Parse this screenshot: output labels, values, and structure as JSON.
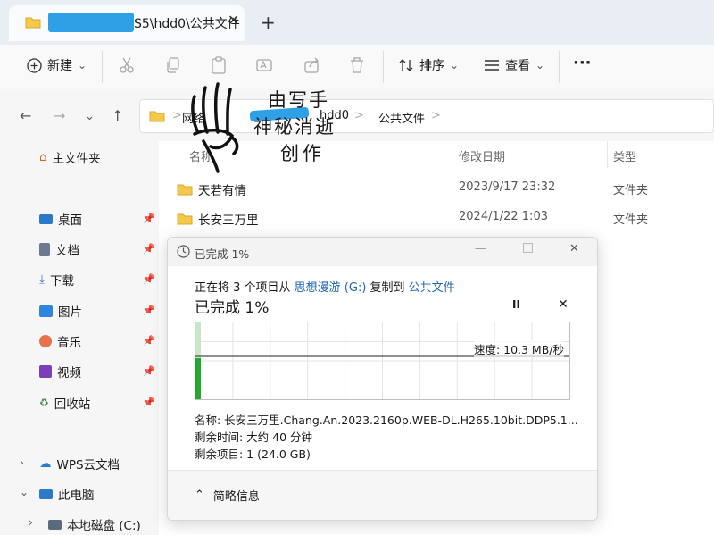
{
  "colors": {
    "accent": "#1f66b8",
    "progress": "#26a830",
    "redaction": "#2ea0e6",
    "folder": "#f5c84c"
  },
  "window": {
    "tab_title": "S5\\hdd0\\公共文件",
    "new_tab": "+",
    "close_icon": "close-icon"
  },
  "toolbar": {
    "new_label": "新建",
    "sort_label": "排序",
    "view_label": "查看",
    "more_label": "···"
  },
  "address": {
    "crumbs": [
      "网络",
      "hdd0",
      "公共文件"
    ],
    "separator": ">"
  },
  "sidebar": {
    "home": "主文件夹",
    "quick": [
      {
        "label": "桌面",
        "icon": "desktop-icon"
      },
      {
        "label": "文档",
        "icon": "document-icon"
      },
      {
        "label": "下载",
        "icon": "download-icon"
      },
      {
        "label": "图片",
        "icon": "pictures-icon"
      },
      {
        "label": "音乐",
        "icon": "music-icon"
      },
      {
        "label": "视频",
        "icon": "video-icon"
      },
      {
        "label": "回收站",
        "icon": "recycle-bin-icon"
      }
    ],
    "wps": "WPS云文档",
    "this_pc": "此电脑",
    "local_disk": "本地磁盘 (C:)"
  },
  "file_list": {
    "columns": {
      "name": "名称",
      "date": "修改日期",
      "type": "类型"
    },
    "rows": [
      {
        "name": "天若有情",
        "date": "2023/9/17 23:32",
        "type": "文件夹"
      },
      {
        "name": "长安三万里",
        "date": "2024/1/22 1:03",
        "type": "文件夹"
      }
    ]
  },
  "dialog": {
    "title": "已完成 1%",
    "line_prefix": "正在将 3 个项目从 ",
    "source": "思想漫游 (G:)",
    "line_mid": " 复制到 ",
    "dest": "公共文件",
    "headline": "已完成 1%",
    "pause": "II",
    "close": "✕",
    "speed": "速度: 10.3 MB/秒",
    "progress_fraction": 0.01,
    "name_line": "名称: 长安三万里.Chang.An.2023.2160p.WEB-DL.H265.10bit.DDP5.1...",
    "time_left": "剩余时间: 大约 40 分钟",
    "items_left": "剩余项目: 1 (24.0 GB)",
    "fewer_details": "简略信息"
  },
  "overlay": {
    "line1": "由写手",
    "line2": "神秘消逝",
    "line3": "创作"
  }
}
